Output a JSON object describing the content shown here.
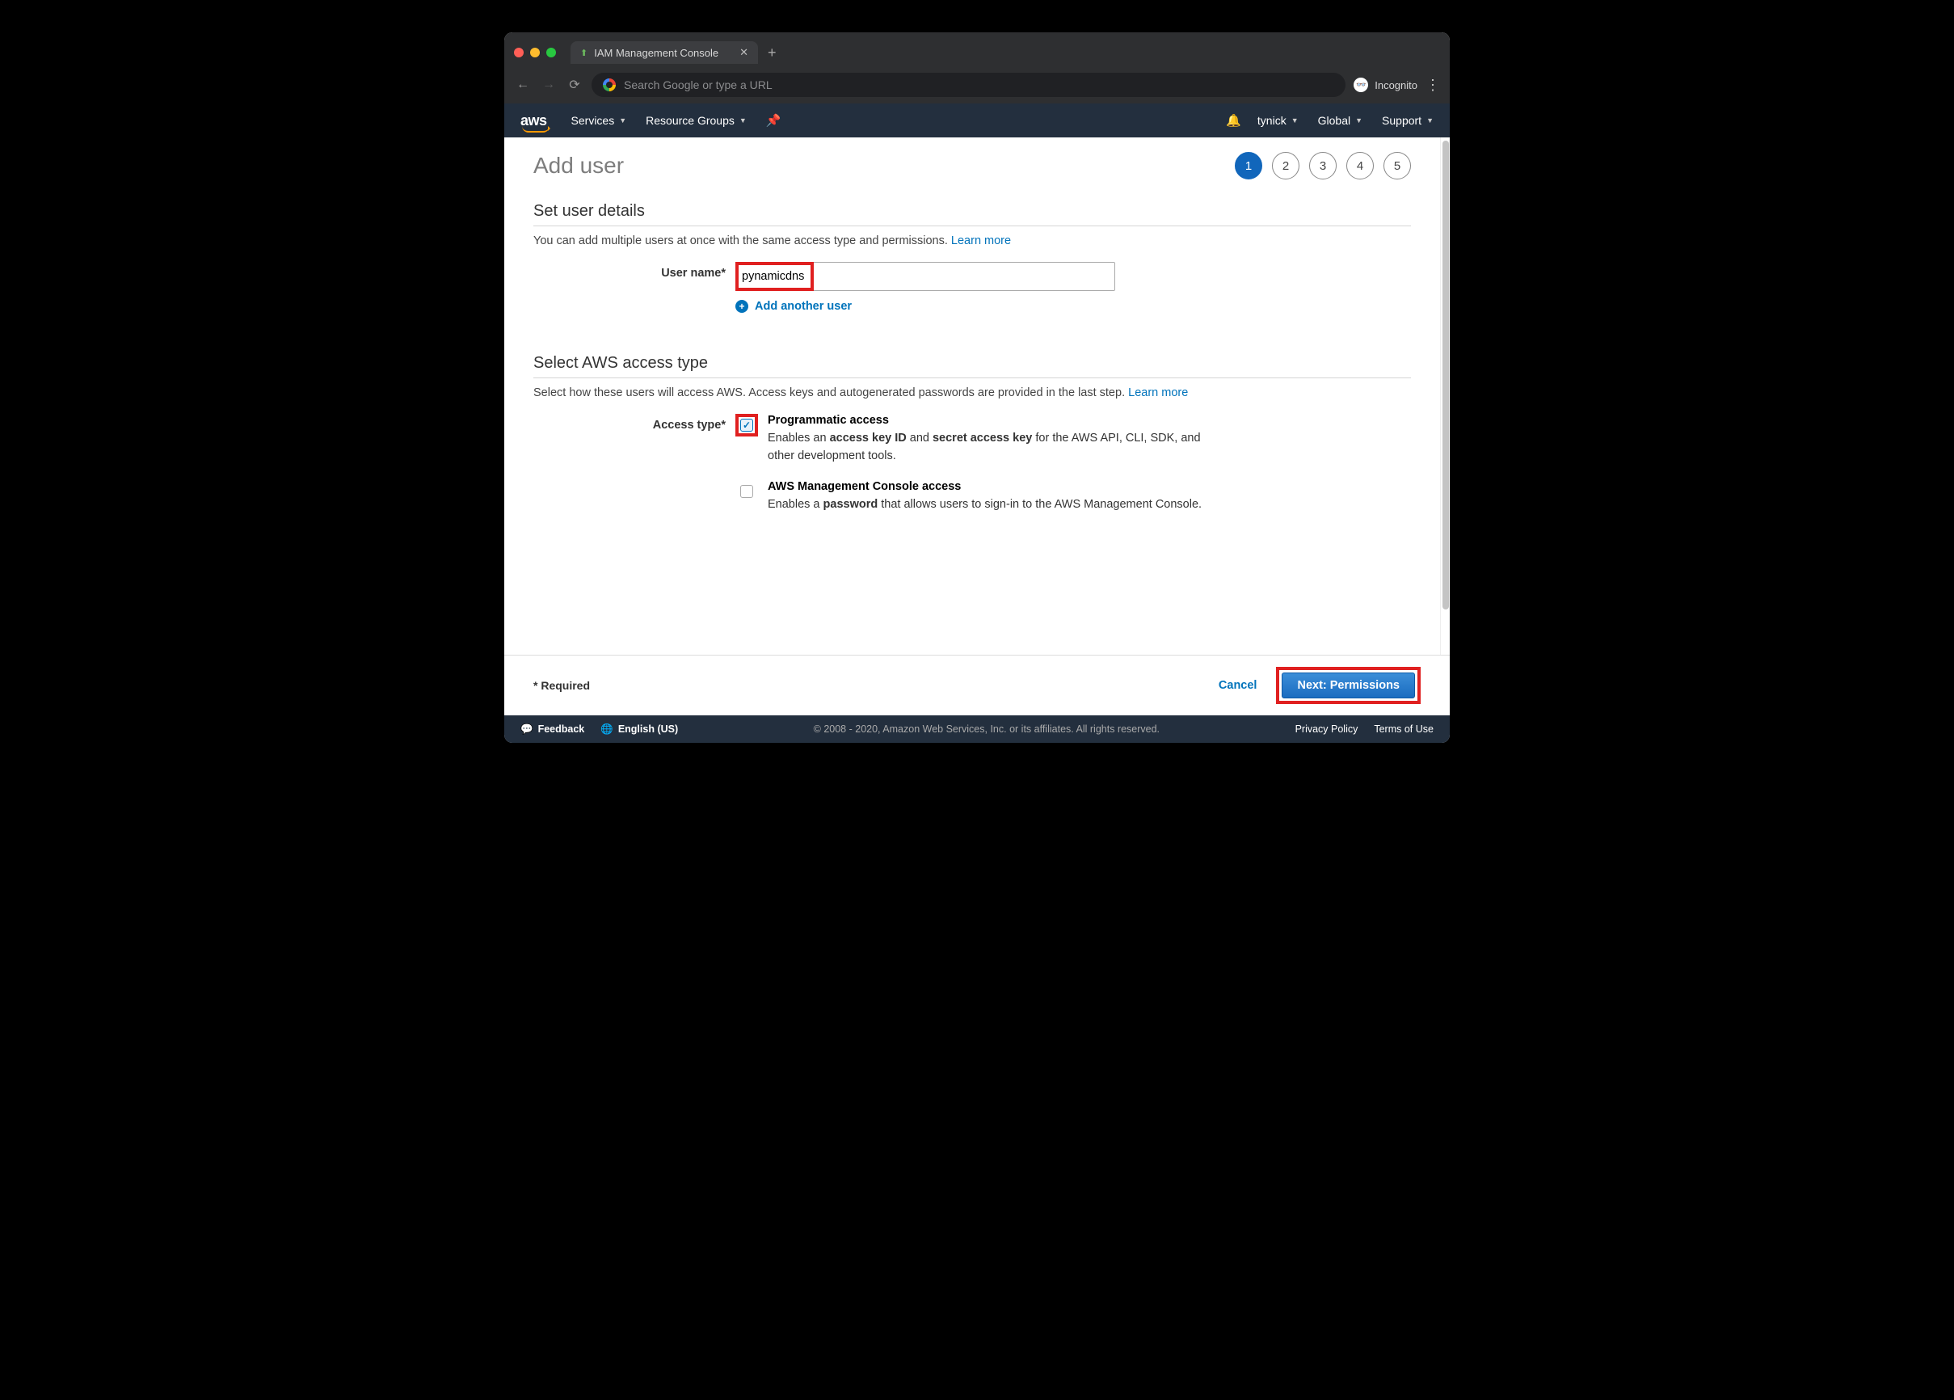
{
  "browser": {
    "tab_title": "IAM Management Console",
    "address_placeholder": "Search Google or type a URL",
    "incognito_label": "Incognito"
  },
  "nav": {
    "services": "Services",
    "resource_groups": "Resource Groups",
    "account": "tynick",
    "region": "Global",
    "support": "Support"
  },
  "page": {
    "title": "Add user",
    "steps": [
      "1",
      "2",
      "3",
      "4",
      "5"
    ],
    "active_step": 0
  },
  "section_details": {
    "heading": "Set user details",
    "desc": "You can add multiple users at once with the same access type and permissions.",
    "learn_more": "Learn more",
    "username_label": "User name*",
    "username_value": "pynamicdns",
    "add_another": "Add another user"
  },
  "section_access": {
    "heading": "Select AWS access type",
    "desc": "Select how these users will access AWS. Access keys and autogenerated passwords are provided in the last step.",
    "learn_more": "Learn more",
    "label": "Access type*",
    "option1": {
      "title": "Programmatic access",
      "desc_pre": "Enables an ",
      "bold1": "access key ID",
      "mid": " and ",
      "bold2": "secret access key",
      "desc_post": " for the AWS API, CLI, SDK, and other development tools.",
      "checked": true
    },
    "option2": {
      "title": "AWS Management Console access",
      "desc_pre": "Enables a ",
      "bold1": "password",
      "desc_post": " that allows users to sign-in to the AWS Management Console.",
      "checked": false
    }
  },
  "actions": {
    "required": "* Required",
    "cancel": "Cancel",
    "next": "Next: Permissions"
  },
  "footer": {
    "feedback": "Feedback",
    "language": "English (US)",
    "copyright": "© 2008 - 2020, Amazon Web Services, Inc. or its affiliates. All rights reserved.",
    "privacy": "Privacy Policy",
    "terms": "Terms of Use"
  }
}
